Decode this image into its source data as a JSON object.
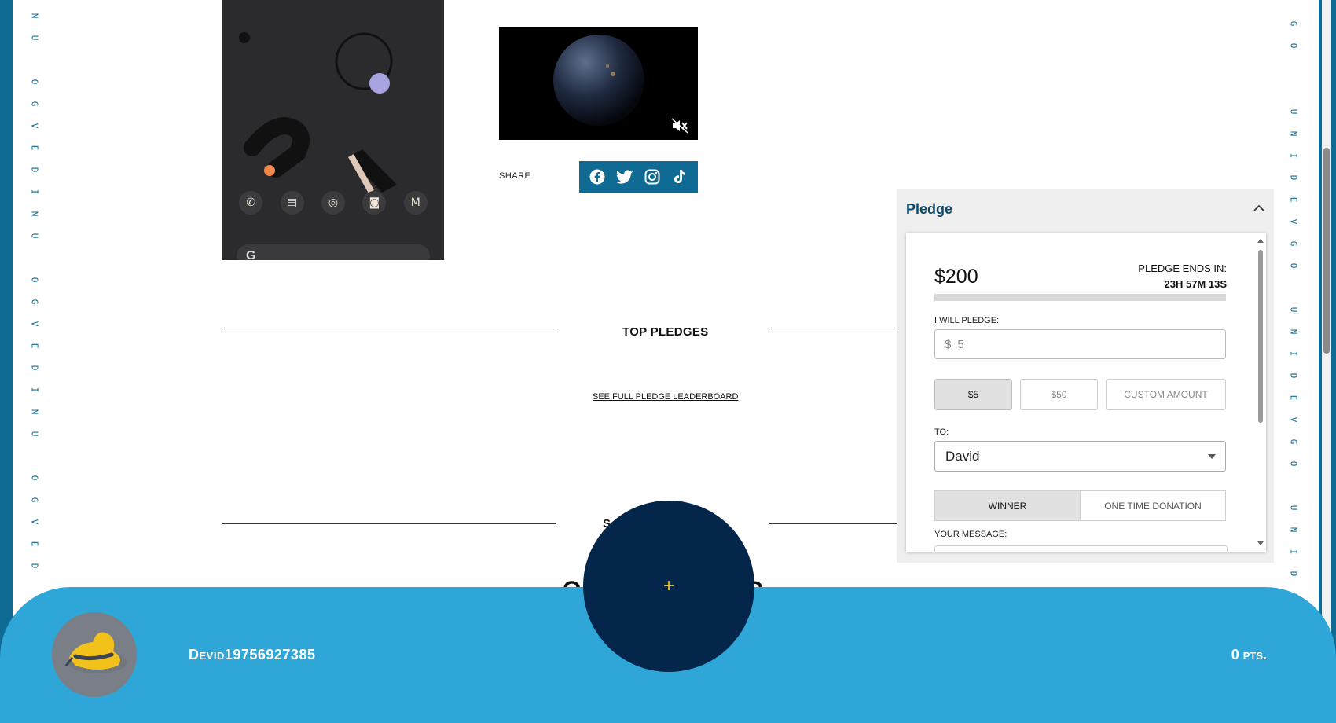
{
  "rails": {
    "left_letters": [
      "N",
      "U",
      "",
      "O",
      "G",
      "V",
      "E",
      "D",
      "I",
      "N",
      "U",
      "",
      "O",
      "G",
      "V",
      "E",
      "D",
      "I",
      "N",
      "U",
      "",
      "O",
      "G",
      "V",
      "E",
      "D"
    ],
    "right_letters": [
      "G",
      "O",
      "",
      "",
      "U",
      "N",
      "I",
      "D",
      "E",
      "V",
      "G",
      "O",
      "",
      "U",
      "N",
      "I",
      "D",
      "E",
      "V",
      "G",
      "O",
      "",
      "U",
      "N",
      "I",
      "D",
      "E"
    ]
  },
  "media": {
    "phone_icon_names": [
      "phone-icon",
      "messages-icon",
      "chrome-icon",
      "camera-icon",
      "gmail-icon"
    ],
    "video_icon": "mute-icon"
  },
  "share": {
    "label": "SHARE",
    "icons": [
      "facebook-icon",
      "twitter-icon",
      "instagram-icon",
      "tiktok-icon"
    ]
  },
  "sections": {
    "top_pledges": "TOP PLEDGES",
    "leaderboard_link": "SEE FULL PLEDGE LEADERBOARD",
    "second_title_fragment": "S"
  },
  "pledge": {
    "title": "Pledge",
    "amount": "$200",
    "ends_label": "PLEDGE ENDS IN:",
    "ends_time": "23H 57M 13S",
    "progress": 0,
    "i_will_pledge_label": "I WILL PLEDGE:",
    "currency": "$",
    "input_placeholder": "5",
    "amount_options": [
      "$5",
      "$50",
      "CUSTOM AMOUNT"
    ],
    "to_label": "TO:",
    "to_value": "David",
    "type_options": [
      "WINNER",
      "ONE TIME DONATION"
    ],
    "message_label": "YOUR MESSAGE:"
  },
  "bottom": {
    "username": "Devid19756927385",
    "points": "0 pts.",
    "fab_symbol": "+"
  },
  "colors": {
    "rail": "#0f6b93",
    "bar": "#2ea6d8",
    "fab": "#04264a",
    "accent": "#f3c21a"
  }
}
